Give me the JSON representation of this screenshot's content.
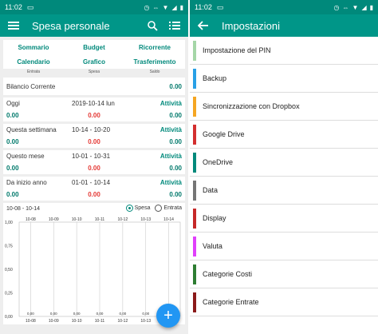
{
  "left": {
    "status": {
      "time": "11:02"
    },
    "appbar": {
      "title": "Spesa personale"
    },
    "menu": [
      "Sommario",
      "Budget",
      "Ricorrente",
      "Calendario",
      "Grafico",
      "Trasferimento"
    ],
    "col_heads": [
      "Entrata",
      "Spesa",
      "Saldo"
    ],
    "balance": {
      "label": "Bilancio Corrente",
      "value": "0.00"
    },
    "periods": [
      {
        "name": "Oggi",
        "dates": "2019-10-14 lun",
        "link": "Attività",
        "entrata": "0.00",
        "spesa": "0.00",
        "saldo": "0.00"
      },
      {
        "name": "Questa settimana",
        "dates": "10-14 - 10-20",
        "link": "Attività",
        "entrata": "0.00",
        "spesa": "0.00",
        "saldo": "0.00"
      },
      {
        "name": "Questo mese",
        "dates": "10-01 - 10-31",
        "link": "Attività",
        "entrata": "0.00",
        "spesa": "0.00",
        "saldo": "0.00"
      },
      {
        "name": "Da inizio anno",
        "dates": "01-01 - 10-14",
        "link": "Attività",
        "entrata": "0.00",
        "spesa": "0.00",
        "saldo": "0.00"
      }
    ],
    "chart": {
      "range": "10-08 - 10-14",
      "radio_spesa": "Spesa",
      "radio_entrata": "Entrata",
      "fab": "+"
    }
  },
  "chart_data": {
    "type": "bar",
    "categories": [
      "10-08",
      "10-09",
      "10-10",
      "10-11",
      "10-12",
      "10-13",
      "10-14"
    ],
    "values": [
      0,
      0,
      0,
      0,
      0,
      0,
      0
    ],
    "value_labels": [
      "0,00",
      "0,00",
      "0,00",
      "0,00",
      "0,00",
      "0,00",
      "0,00"
    ],
    "y_ticks": [
      "1,00",
      "0,75",
      "0,50",
      "0,25",
      "0,00"
    ],
    "ylim": [
      0,
      1
    ],
    "grid": true
  },
  "right": {
    "status": {
      "time": "11:02"
    },
    "appbar": {
      "title": "Impostazioni"
    },
    "items": [
      {
        "label": "Impostazione del PIN",
        "color": "#a5d6a7"
      },
      {
        "label": "Backup",
        "color": "#29a0e6"
      },
      {
        "label": "Sincronizzazione con Dropbox",
        "color": "#f5a623"
      },
      {
        "label": "Google Drive",
        "color": "#d32f2f"
      },
      {
        "label": "OneDrive",
        "color": "#00897b"
      },
      {
        "label": "Data",
        "color": "#757575"
      },
      {
        "label": "Display",
        "color": "#c62828"
      },
      {
        "label": "Valuta",
        "color": "#e040fb"
      },
      {
        "label": "Categorie Costi",
        "color": "#2e7d32"
      },
      {
        "label": "Categorie Entrate",
        "color": "#8b1a1a"
      }
    ]
  }
}
